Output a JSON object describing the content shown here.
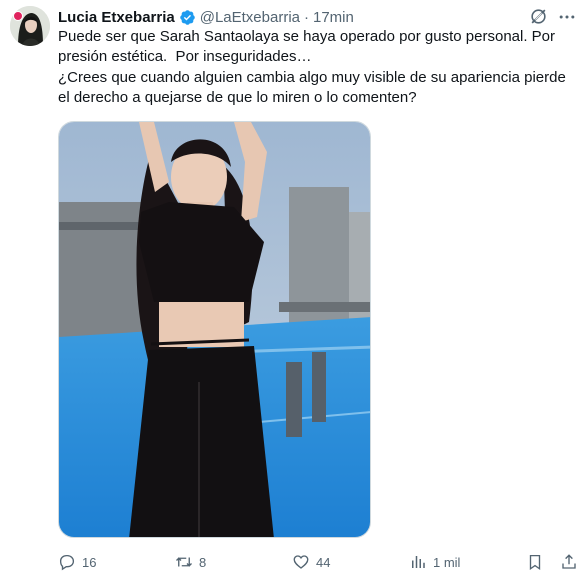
{
  "author": {
    "name": "Lucia Etxebarria",
    "handle": "@LaEtxebarria",
    "time": "17min"
  },
  "tweet": {
    "line1": "Puede ser que Sarah Santaolaya se haya operado por gusto personal. Por presión estética.  Por inseguridades…",
    "line2": "¿Crees que cuando alguien cambia algo muy visible de su apariencia pierde el derecho a quejarse de que lo miren o lo comenten?"
  },
  "actions": {
    "replies": "16",
    "reposts": "8",
    "likes": "44",
    "views": "1 mil"
  },
  "colors": {
    "accent": "#1d9bf0",
    "muted": "#536471",
    "text": "#0f1419"
  },
  "icons": [
    "verified-badge-icon",
    "grok-icon",
    "more-icon",
    "reply-icon",
    "repost-icon",
    "like-icon",
    "views-icon",
    "bookmark-icon",
    "share-icon"
  ]
}
